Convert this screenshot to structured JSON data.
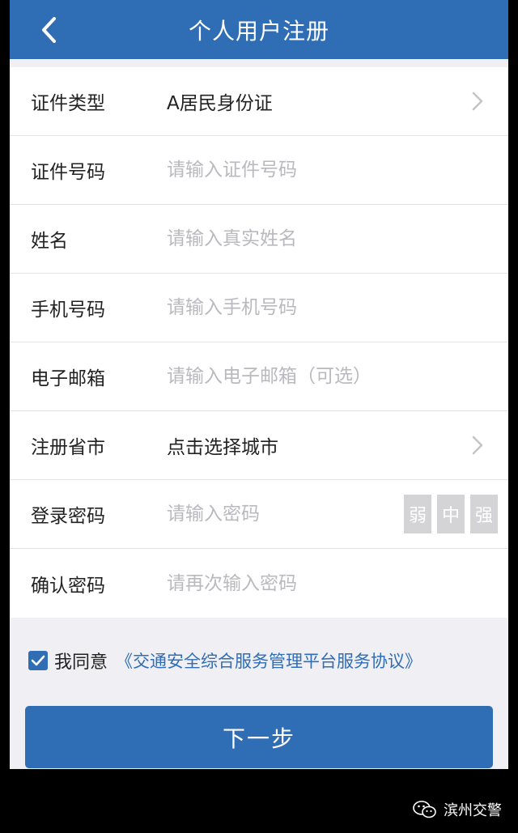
{
  "header": {
    "title": "个人用户注册",
    "back_icon": "chevron-left-icon"
  },
  "form": {
    "id_type": {
      "label": "证件类型",
      "value": "A居民身份证"
    },
    "id_number": {
      "label": "证件号码",
      "placeholder": "请输入证件号码"
    },
    "name": {
      "label": "姓名",
      "placeholder": "请输入真实姓名"
    },
    "phone": {
      "label": "手机号码",
      "placeholder": "请输入手机号码"
    },
    "email": {
      "label": "电子邮箱",
      "placeholder": "请输入电子邮箱（可选）"
    },
    "city": {
      "label": "注册省市",
      "value": "点击选择城市"
    },
    "password": {
      "label": "登录密码",
      "placeholder": "请输入密码",
      "strength": [
        "弱",
        "中",
        "强"
      ]
    },
    "confirm_password": {
      "label": "确认密码",
      "placeholder": "请再次输入密码"
    }
  },
  "agreement": {
    "checked": true,
    "text": "我同意",
    "link": "《交通安全综合服务管理平台服务协议》"
  },
  "next_button": "下一步",
  "watermark": "滨州交警",
  "colors": {
    "primary": "#2f6db5",
    "background": "#efeff4",
    "placeholder": "#b9b9be",
    "strength_box": "#d4d4d6"
  }
}
